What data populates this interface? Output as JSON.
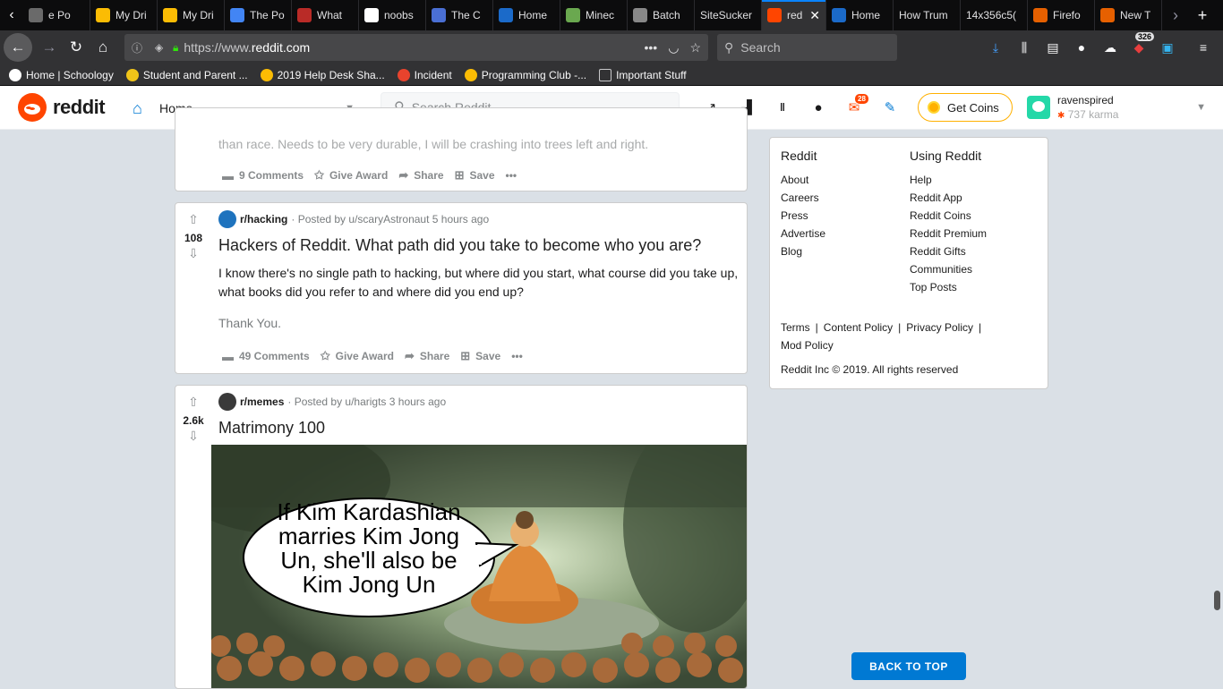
{
  "browser": {
    "tabs": [
      {
        "label": "e Po",
        "icon": "page-icon",
        "color": "#6a6a6a"
      },
      {
        "label": "My Dri",
        "icon": "drive-icon",
        "color": "#fbbc04"
      },
      {
        "label": "My Dri",
        "icon": "drive-icon",
        "color": "#fbbc04"
      },
      {
        "label": "The Po",
        "icon": "docs-icon",
        "color": "#4285f4"
      },
      {
        "label": "What",
        "icon": "quora-icon",
        "color": "#b92b27"
      },
      {
        "label": "noobs",
        "icon": "google-icon",
        "color": "#ffffff"
      },
      {
        "label": "The C",
        "icon": "globe-icon",
        "color": "#4a6fd4"
      },
      {
        "label": "Home",
        "icon": "schoology-icon",
        "color": "#1b6ac9"
      },
      {
        "label": "Minec",
        "icon": "minecraft-icon",
        "color": "#6aa84f"
      },
      {
        "label": "Batch",
        "icon": "batch-icon",
        "color": "#888888"
      },
      {
        "label": "SiteSucker",
        "icon": "",
        "color": ""
      },
      {
        "label": "red",
        "icon": "reddit-icon",
        "color": "#ff4500",
        "active": true
      },
      {
        "label": "Home",
        "icon": "schoology-icon",
        "color": "#1b6ac9"
      },
      {
        "label": "How Trum",
        "icon": "",
        "color": ""
      },
      {
        "label": "14x356c5(",
        "icon": "",
        "color": ""
      },
      {
        "label": "Firefo",
        "icon": "firefox-icon",
        "color": "#e66000"
      },
      {
        "label": "New T",
        "icon": "firefox-icon",
        "color": "#e66000"
      }
    ],
    "url_prefix": "https://www.",
    "url_host": "reddit.com",
    "search_placeholder": "Search",
    "downloads_badge": "326",
    "bookmarks": [
      {
        "label": "Home | Schoology",
        "icon": "schoology-icon",
        "color": "#ffffff"
      },
      {
        "label": "Student and Parent ...",
        "icon": "powerschool-icon",
        "color": "#f0c419"
      },
      {
        "label": "2019 Help Desk Sha...",
        "icon": "drive-icon",
        "color": "#fbbc04"
      },
      {
        "label": "Incident",
        "icon": "incident-icon",
        "color": "#e8432d"
      },
      {
        "label": "Programming Club -...",
        "icon": "drive-icon",
        "color": "#fbbc04"
      },
      {
        "label": "Important Stuff",
        "icon": "folder-icon",
        "color": "#c8c8ca"
      }
    ]
  },
  "reddit": {
    "wordmark": "reddit",
    "feed_selector": "Home",
    "search_placeholder": "Search Reddit",
    "notifications": "28",
    "get_coins": "Get Coins",
    "username": "ravenspired",
    "karma": "737 karma"
  },
  "posts": {
    "p0": {
      "text_partial": "than race. Needs to be very durable, I will be crashing into trees left and right.",
      "comments": "9 Comments",
      "award": "Give Award",
      "share": "Share",
      "save": "Save"
    },
    "p1": {
      "score": "108",
      "subreddit": "r/hacking",
      "posted_by": "· Posted by u/scaryAstronaut 5 hours ago",
      "title": "Hackers of Reddit. What path did you take to become who you are?",
      "body": "I know there's no single path to hacking, but where did you start, what course did you take up, what books did you refer to and where did you end up?",
      "body2": "Thank You.",
      "comments": "49 Comments",
      "award": "Give Award",
      "share": "Share",
      "save": "Save"
    },
    "p2": {
      "score": "2.6k",
      "subreddit": "r/memes",
      "posted_by": "· Posted by u/harigts 3 hours ago",
      "title": "Matrimony 100",
      "meme_line1": "If Kim Kardashian",
      "meme_line2": "marries Kim Jong",
      "meme_line3": "Un, she'll also be",
      "meme_line4": "Kim Jong Un"
    }
  },
  "sidebar": {
    "col1_title": "Reddit",
    "col1_links": [
      "About",
      "Careers",
      "Press",
      "Advertise",
      "Blog"
    ],
    "col2_title": "Using Reddit",
    "col2_links": [
      "Help",
      "Reddit App",
      "Reddit Coins",
      "Reddit Premium",
      "Reddit Gifts",
      "Communities",
      "Top Posts"
    ],
    "terms": "Terms",
    "content_policy": "Content Policy",
    "privacy_policy": "Privacy Policy",
    "mod_policy": "Mod Policy",
    "copyright": "Reddit Inc © 2019. All rights reserved"
  },
  "back_to_top": "BACK TO TOP"
}
